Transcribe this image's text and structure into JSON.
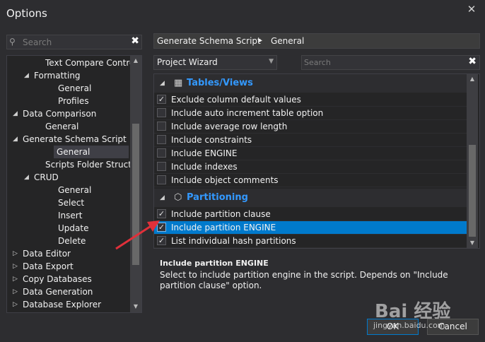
{
  "window": {
    "title": "Options",
    "close_glyph": "✕"
  },
  "left_search": {
    "placeholder": "Search",
    "clear_glyph": "✖"
  },
  "tree": {
    "items": [
      {
        "label": "Text Compare Control",
        "toggle": ""
      },
      {
        "label": "Formatting",
        "toggle": "◢"
      },
      {
        "label": "General",
        "toggle": ""
      },
      {
        "label": "Profiles",
        "toggle": ""
      },
      {
        "label": "Data Comparison",
        "toggle": "◢"
      },
      {
        "label": "General",
        "toggle": ""
      },
      {
        "label": "Generate Schema Script",
        "toggle": "◢"
      },
      {
        "label": "General",
        "toggle": "",
        "selected": true
      },
      {
        "label": "Scripts Folder Structure",
        "toggle": ""
      },
      {
        "label": "CRUD",
        "toggle": "◢"
      },
      {
        "label": "General",
        "toggle": ""
      },
      {
        "label": "Select",
        "toggle": ""
      },
      {
        "label": "Insert",
        "toggle": ""
      },
      {
        "label": "Update",
        "toggle": ""
      },
      {
        "label": "Delete",
        "toggle": ""
      },
      {
        "label": "Data Editor",
        "toggle": "▷"
      },
      {
        "label": "Data Export",
        "toggle": "▷"
      },
      {
        "label": "Copy Databases",
        "toggle": "▷"
      },
      {
        "label": "Data Generation",
        "toggle": "▷"
      },
      {
        "label": "Database Explorer",
        "toggle": "▷"
      }
    ]
  },
  "breadcrumb": {
    "parent": "Generate Schema Script",
    "separator": "▸",
    "current": "General"
  },
  "category_combo": {
    "value": "Project Wizard"
  },
  "right_search": {
    "placeholder": "Search",
    "clear_glyph": "✖"
  },
  "groups": [
    {
      "label": "Tables/Views",
      "icon": "table-icon",
      "glyph": "▦"
    },
    {
      "label": "Partitioning",
      "icon": "cube-icon",
      "glyph": "⬡"
    }
  ],
  "options_tables": [
    {
      "label": "Exclude column default values",
      "checked": true
    },
    {
      "label": "Include auto increment table option",
      "checked": false
    },
    {
      "label": "Include average row length",
      "checked": false
    },
    {
      "label": "Include constraints",
      "checked": false
    },
    {
      "label": "Include ENGINE",
      "checked": false
    },
    {
      "label": "Include indexes",
      "checked": false
    },
    {
      "label": "Include object comments",
      "checked": false
    }
  ],
  "options_partitioning": [
    {
      "label": "Include partition clause",
      "checked": true
    },
    {
      "label": "Include partition ENGINE",
      "checked": true,
      "selected": true
    },
    {
      "label": "List individual hash partitions",
      "checked": true
    }
  ],
  "description": {
    "title": "Include partition ENGINE",
    "text": "Select to include partition engine in the script. Depends on \"Include partition clause\" option."
  },
  "buttons": {
    "ok": "OK",
    "cancel": "Cancel"
  },
  "watermark": {
    "brand": "Bai 经验",
    "site": "jingyan.baidu.com"
  },
  "colors": {
    "accent": "#007acc",
    "group_text": "#3399ff",
    "arrow": "#e0303a"
  }
}
